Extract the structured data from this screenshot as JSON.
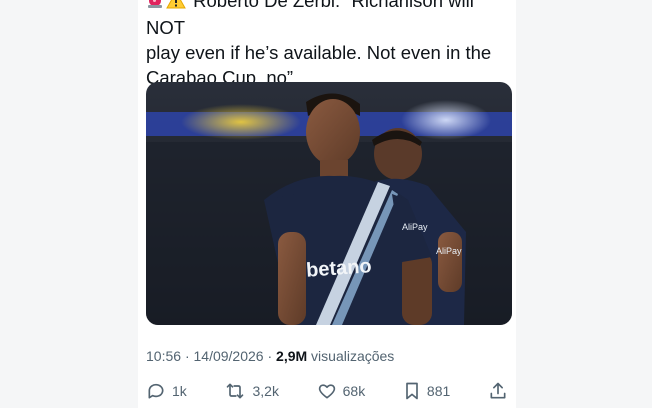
{
  "tweet": {
    "text_line1": "Roberto De Zerbi: “Richarlison will NOT",
    "text_line2": "play even if he’s available. Not even in the",
    "text_line3": "Carabao Cup, no”.",
    "emoji_icons": [
      "siren-icon",
      "warning-icon"
    ]
  },
  "media": {
    "jersey_sponsor": "betano",
    "sleeve_sponsor": "AliPay",
    "description_colors": {
      "jersey": "#1c2640",
      "stripe": "#d9e6f3",
      "bg": "#1e2330"
    }
  },
  "meta": {
    "time": "10:56",
    "separator": "·",
    "date": "14/09/2026",
    "views_count": "2,9M",
    "views_label": "visualizações"
  },
  "actions": {
    "reply_count": "1k",
    "retweet_count": "3,2k",
    "like_count": "68k",
    "bookmark_count": "881"
  },
  "colors": {
    "text": "#0f1419",
    "secondary": "#536471",
    "background": "#ffffff"
  }
}
